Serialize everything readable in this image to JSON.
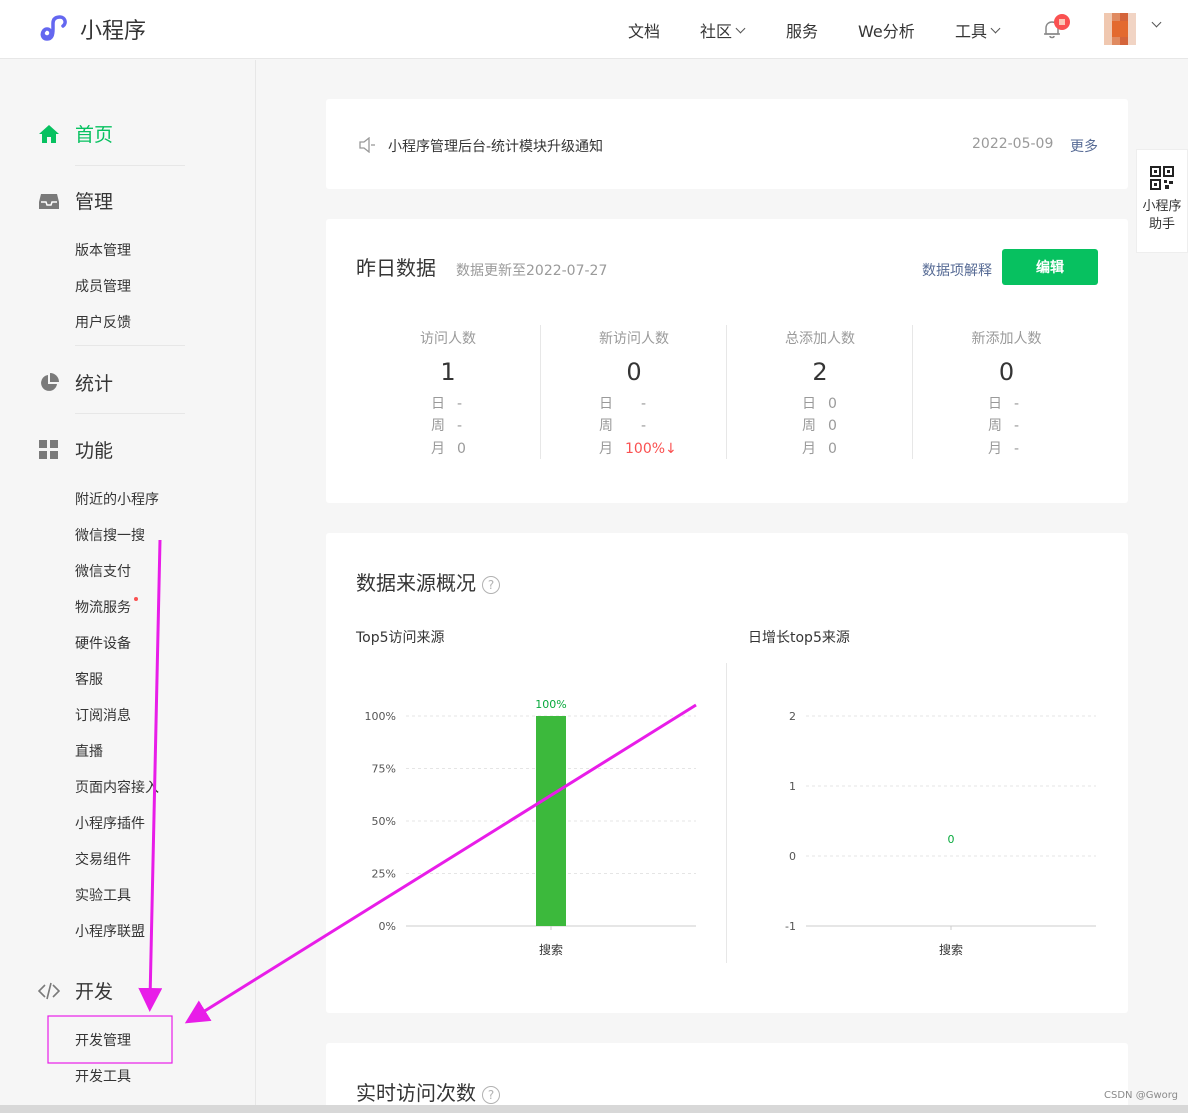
{
  "header": {
    "app_name": "小程序",
    "nav": [
      {
        "label": "文档",
        "dropdown": false
      },
      {
        "label": "社区",
        "dropdown": true
      },
      {
        "label": "服务",
        "dropdown": false
      },
      {
        "label": "We分析",
        "dropdown": false
      },
      {
        "label": "工具",
        "dropdown": true
      }
    ],
    "icons": {
      "logo": "miniprogram-logo-icon",
      "bell": "bell-icon",
      "avatar": "user-avatar"
    },
    "accent": "#07c160"
  },
  "sidebar": {
    "home": {
      "label": "首页",
      "icon": "home-icon"
    },
    "manage": {
      "label": "管理",
      "icon": "inbox-icon",
      "items": [
        "版本管理",
        "成员管理",
        "用户反馈"
      ]
    },
    "stats": {
      "label": "统计",
      "icon": "pie-chart-icon"
    },
    "features": {
      "label": "功能",
      "icon": "grid-icon",
      "items": [
        "附近的小程序",
        "微信搜一搜",
        "微信支付",
        "物流服务",
        "硬件设备",
        "客服",
        "订阅消息",
        "直播",
        "页面内容接入",
        "小程序插件",
        "交易组件",
        "实验工具",
        "小程序联盟"
      ]
    },
    "dev": {
      "label": "开发",
      "icon": "code-icon",
      "items": [
        "开发管理",
        "开发工具"
      ]
    }
  },
  "notice": {
    "text": "小程序管理后台-统计模块升级通知",
    "date": "2022-05-09",
    "more": "更多"
  },
  "yesterday": {
    "title": "昨日数据",
    "updated": "数据更新至2022-07-27",
    "explain": "数据项解释",
    "edit": "编辑",
    "row_labels": {
      "day": "日",
      "week": "周",
      "month": "月"
    },
    "columns": [
      {
        "label": "访问人数",
        "value": "1",
        "day": "-",
        "week": "-",
        "month": "0"
      },
      {
        "label": "新访问人数",
        "value": "0",
        "day": "-",
        "week": "-",
        "month": "100%↓"
      },
      {
        "label": "总添加人数",
        "value": "2",
        "day": "0",
        "week": "0",
        "month": "0"
      },
      {
        "label": "新添加人数",
        "value": "0",
        "day": "-",
        "week": "-",
        "month": "-"
      }
    ]
  },
  "sources": {
    "title": "数据来源概况",
    "help": "?",
    "top5_title": "Top5访问来源",
    "growth_title": "日增长top5来源"
  },
  "chart_data": [
    {
      "type": "bar",
      "title": "Top5访问来源",
      "categories": [
        "搜索"
      ],
      "values": [
        100
      ],
      "data_labels": [
        "100%"
      ],
      "yticks": [
        "0%",
        "25%",
        "50%",
        "75%",
        "100%"
      ],
      "ylim": [
        0,
        100
      ],
      "color": "#3cb93c"
    },
    {
      "type": "bar",
      "title": "日增长top5来源",
      "categories": [
        "搜索"
      ],
      "values": [
        0
      ],
      "data_labels": [
        "0"
      ],
      "yticks": [
        "-1",
        "0",
        "1",
        "2"
      ],
      "ylim": [
        -1,
        2
      ],
      "color": "#3cb93c"
    }
  ],
  "realtime": {
    "title": "实时访问次数",
    "help": "?"
  },
  "qr_helper": {
    "label_line1": "小程序",
    "label_line2": "助手",
    "icon": "qr-code-icon"
  },
  "watermark": "CSDN @Gworg"
}
